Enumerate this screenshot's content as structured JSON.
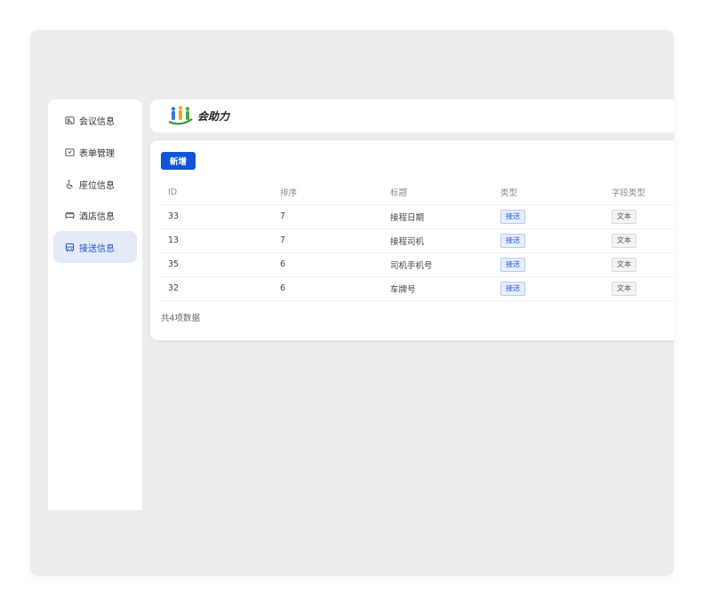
{
  "app": {
    "logo_text": "会助力"
  },
  "sidebar": {
    "items": [
      {
        "label": "会议信息",
        "icon": "meeting-icon",
        "active": false
      },
      {
        "label": "表单管理",
        "icon": "form-icon",
        "active": false
      },
      {
        "label": "座位信息",
        "icon": "seat-icon",
        "active": false
      },
      {
        "label": "酒店信息",
        "icon": "hotel-bed-icon",
        "active": false
      },
      {
        "label": "接送信息",
        "icon": "bus-icon",
        "active": true
      }
    ]
  },
  "toolbar": {
    "new_label": "新增"
  },
  "table": {
    "columns": [
      "ID",
      "排序",
      "标题",
      "类型",
      "字段类型"
    ],
    "rows": [
      {
        "id": "33",
        "order": "7",
        "title": "接程日期",
        "type": "接送",
        "field_type": "文本"
      },
      {
        "id": "13",
        "order": "7",
        "title": "接程司机",
        "type": "接送",
        "field_type": "文本"
      },
      {
        "id": "35",
        "order": "6",
        "title": "司机手机号",
        "type": "接送",
        "field_type": "文本"
      },
      {
        "id": "32",
        "order": "6",
        "title": "车牌号",
        "type": "接送",
        "field_type": "文本"
      }
    ]
  },
  "footer": {
    "count_text": "共4项数据"
  },
  "colors": {
    "accent": "#1154d8",
    "active_bg": "#e4ebf7",
    "tag_blue_bg": "#e6eefc",
    "tag_gray_bg": "#f3f3f3"
  }
}
